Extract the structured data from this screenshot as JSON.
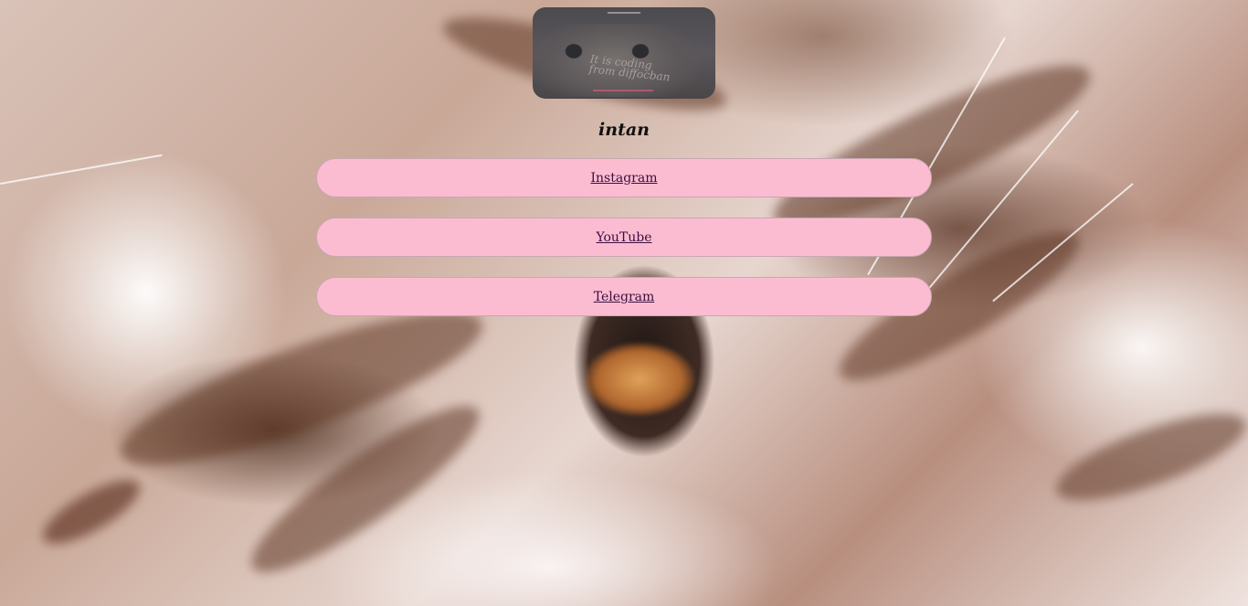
{
  "profile": {
    "username": "intan",
    "avatar_caption": "It is coding\nfrom diffocban"
  },
  "links": [
    {
      "label": "Instagram"
    },
    {
      "label": "YouTube"
    },
    {
      "label": "Telegram"
    }
  ],
  "colors": {
    "button_bg": "#fbbcd1",
    "button_border": "#c9a6b2",
    "link_text": "#3a0f3f",
    "username_text": "#111111"
  }
}
